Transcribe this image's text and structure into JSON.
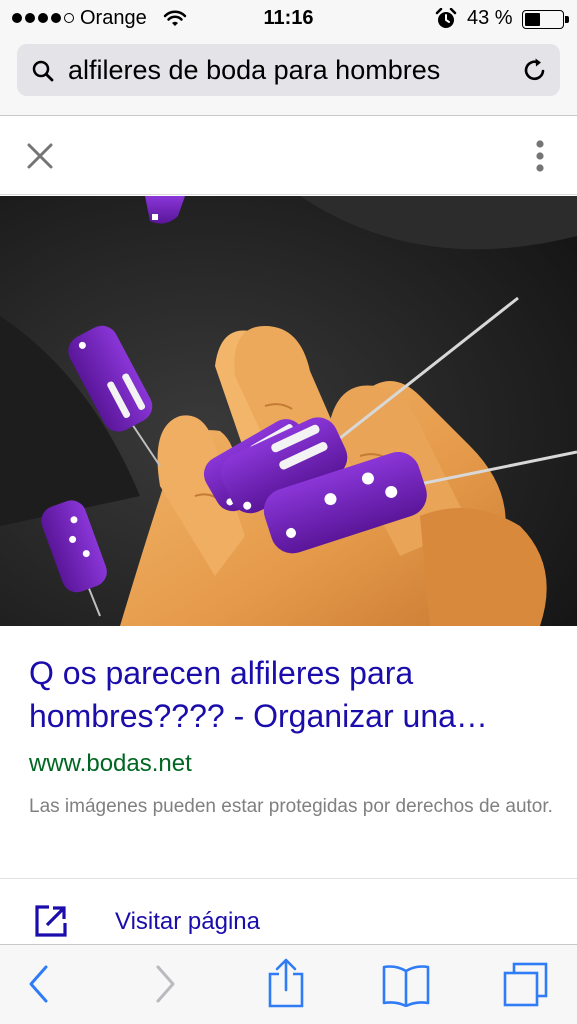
{
  "status_bar": {
    "carrier": "Orange",
    "time": "11:16",
    "battery_percent": "43 %",
    "battery_level": 0.43,
    "signal_bars_filled": 4,
    "signal_bars_total": 5
  },
  "url_bar": {
    "query": "alfileres de boda para hombres",
    "search_icon": "search-icon",
    "reload_icon": "reload-icon"
  },
  "viewer": {
    "close_icon": "close-icon",
    "more_icon": "more-vertical-icon"
  },
  "result": {
    "title": "Q os parecen alfileres para hombres???? - Organizar una…",
    "site": "www.bodas.net",
    "copyright_note": "Las imágenes pueden estar protegidas por derechos de autor.",
    "visit_label": "Visitar página",
    "visit_icon": "open-external-icon"
  },
  "toolbar": {
    "back_icon": "back-icon",
    "forward_icon": "forward-icon",
    "share_icon": "share-icon",
    "bookmarks_icon": "bookmarks-icon",
    "tabs_icon": "tabs-icon"
  },
  "colors": {
    "link": "#1a0dab",
    "url_green": "#006621",
    "ios_blue": "#2f7cf6",
    "pin_purple": "#6a1fb0"
  }
}
